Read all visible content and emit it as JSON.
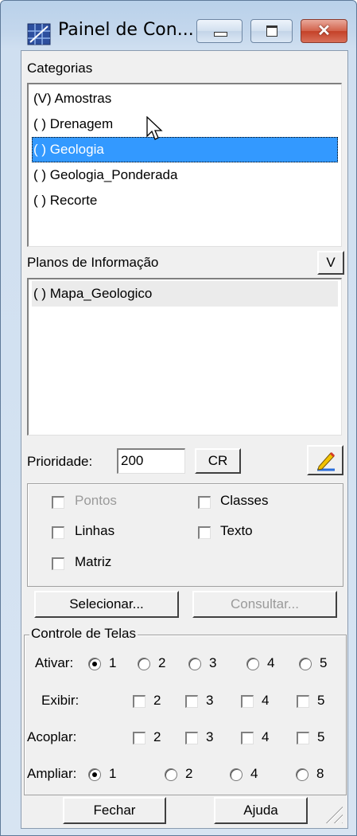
{
  "window": {
    "title": "Painel de Con...",
    "icon": "grid-map-icon",
    "close_glyph": "✕"
  },
  "categorias": {
    "label": "Categorias",
    "items": [
      {
        "label": "(V) Amostras",
        "selected": false
      },
      {
        "label": "( ) Drenagem",
        "selected": false
      },
      {
        "label": "( ) Geologia",
        "selected": true
      },
      {
        "label": "( ) Geologia_Ponderada",
        "selected": false
      },
      {
        "label": "( ) Recorte",
        "selected": false
      }
    ]
  },
  "planos": {
    "label": "Planos de Informação",
    "v_button": "V",
    "items": [
      {
        "label": "( ) Mapa_Geologico"
      }
    ]
  },
  "prioridade": {
    "label": "Prioridade:",
    "value": "200",
    "cr_button": "CR",
    "color_button_icon": "pencil-color-icon"
  },
  "options": {
    "pontos": {
      "label": "Pontos",
      "checked": false,
      "disabled": true
    },
    "classes": {
      "label": "Classes",
      "checked": false
    },
    "linhas": {
      "label": "Linhas",
      "checked": false
    },
    "texto": {
      "label": "Texto",
      "checked": false
    },
    "matriz": {
      "label": "Matriz",
      "checked": false
    }
  },
  "actions": {
    "selecionar": "Selecionar...",
    "consultar": "Consultar..."
  },
  "controle": {
    "legend": "Controle de Telas",
    "ativar": {
      "label": "Ativar:",
      "options": [
        "1",
        "2",
        "3",
        "4",
        "5"
      ],
      "selected": "1"
    },
    "exibir": {
      "label": "Exibir:",
      "options": [
        "2",
        "3",
        "4",
        "5"
      ]
    },
    "acoplar": {
      "label": "Acoplar:",
      "options": [
        "2",
        "3",
        "4",
        "5"
      ]
    },
    "ampliar": {
      "label": "Ampliar:",
      "options": [
        "1",
        "2",
        "4",
        "8"
      ],
      "selected": "1"
    }
  },
  "footer": {
    "fechar": "Fechar",
    "ajuda": "Ajuda"
  },
  "colors": {
    "selection": "#3399ff",
    "titlebar": "#c4d7ec",
    "close_button": "#c44128"
  }
}
